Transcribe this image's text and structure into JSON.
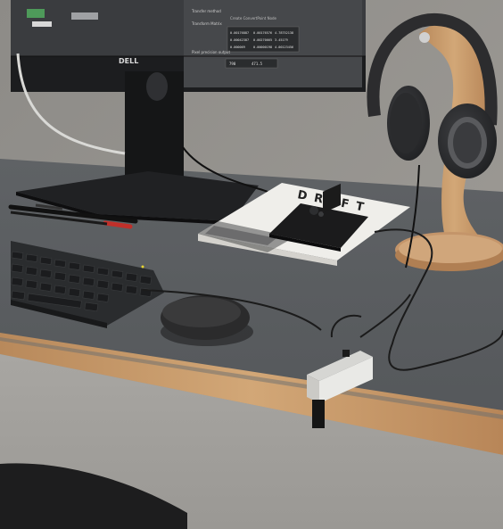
{
  "scene": {
    "monitor_brand": "DELL",
    "book_title": "DRIFT",
    "screen_labels": {
      "transform_method": "Transform Matrix",
      "create_text": "Create ConvertPoint Node",
      "transfer_method": "Transfer method",
      "pixel_precision": "Pixel precision output",
      "matrix_values": [
        "0.00176887",
        "0.00176576",
        "4.78752138",
        "0.00042387",
        "0.00270665",
        "3.45179",
        "0.000069",
        "0.00000198",
        "4.00123456"
      ],
      "readout": [
        "790",
        "471.5"
      ]
    }
  },
  "colors": {
    "wall": "#8f8d89",
    "desk_top": "#5a5d60",
    "desk_edge": "#b88658",
    "keyboard": "#2a2c2e",
    "mouse": "#2b2b2c",
    "headphones": "#2c2c2e",
    "stand_wood": "#c89b6c",
    "hub": "#e9e9e6",
    "book": "#efeeea",
    "phone": "#1b1b1c"
  }
}
